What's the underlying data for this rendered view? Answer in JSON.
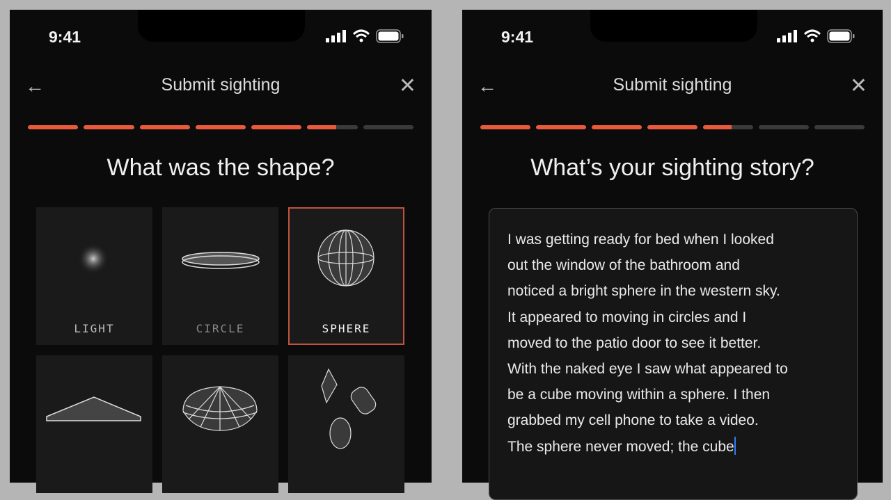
{
  "status_bar": {
    "time": "9:41",
    "icons": [
      "cellular-signal-icon",
      "wifi-icon",
      "battery-icon"
    ]
  },
  "colors": {
    "accent": "#e95a3c",
    "background": "#0b0b0b",
    "tile": "#1a1a1a"
  },
  "screens": [
    {
      "header": {
        "title": "Submit sighting",
        "back_icon": "arrow-left-icon",
        "close_icon": "close-icon",
        "back": "←",
        "close": "✕"
      },
      "progress": {
        "segments": 7,
        "fill": [
          1,
          1,
          1,
          1,
          1,
          0.58,
          0
        ]
      },
      "question": "What was the shape?",
      "shapes": [
        {
          "label": "LIGHT",
          "icon": "light-glow-icon",
          "selected": false
        },
        {
          "label": "CIRCLE",
          "icon": "disc-ring-icon",
          "selected": false
        },
        {
          "label": "SPHERE",
          "icon": "wireframe-sphere-icon",
          "selected": true
        },
        {
          "label": "",
          "icon": "triangle-icon",
          "selected": false
        },
        {
          "label": "",
          "icon": "dome-icon",
          "selected": false
        },
        {
          "label": "",
          "icon": "multiple-shapes-icon",
          "selected": false
        }
      ]
    },
    {
      "header": {
        "title": "Submit sighting",
        "back": "←",
        "close": "✕"
      },
      "progress": {
        "segments": 7,
        "fill": [
          1,
          1,
          1,
          1,
          0.57,
          0,
          0
        ]
      },
      "question": "What’s your sighting story?",
      "story_lines": [
        "I was getting ready for bed when I looked",
        "out the window of the bathroom and",
        "noticed a bright sphere in the western sky.",
        "It appeared to moving in circles and I",
        "moved to the patio door to see it better.",
        "With the naked eye I saw what appeared to",
        "be a cube moving within a sphere. I then",
        "grabbed my cell phone to take a video.",
        "The sphere never moved; the cube"
      ]
    }
  ]
}
